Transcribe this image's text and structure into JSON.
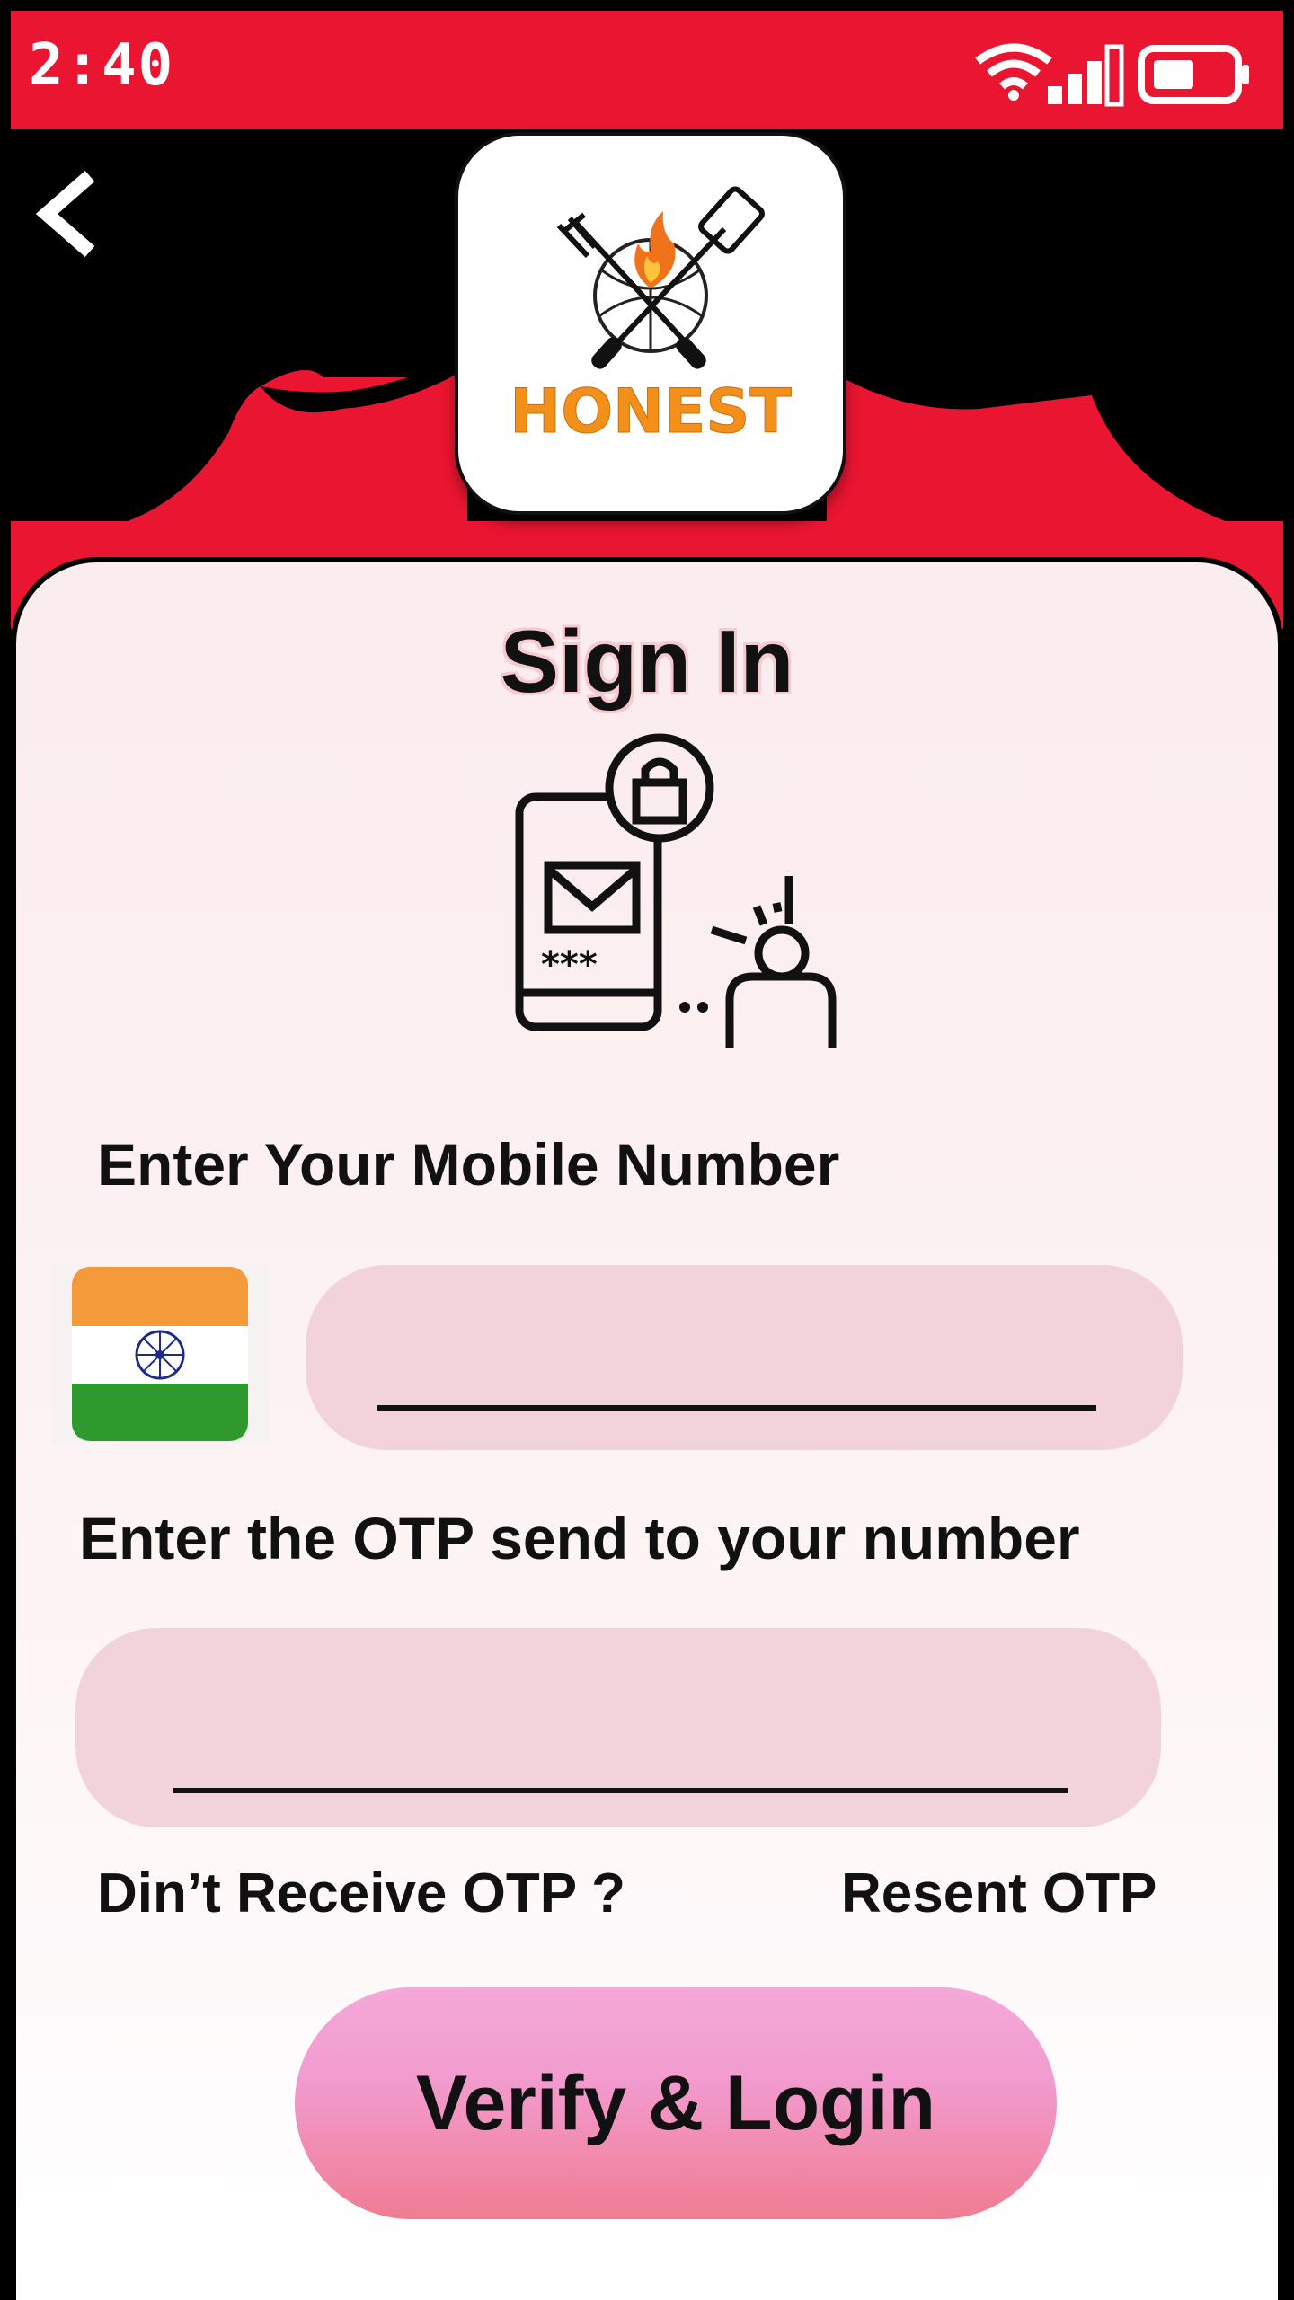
{
  "status_bar": {
    "time": "2:40",
    "battery_icon": "battery-half-icon",
    "signal_icon": "cell-signal-icon",
    "wifi_icon": "wifi-icon"
  },
  "header": {
    "back_icon": "chevron-left-icon",
    "logo_text": "HONEST"
  },
  "main": {
    "title": "Sign In",
    "mobile_label": "Enter Your Mobile Number",
    "mobile_value": "",
    "country_flag": "india-flag",
    "otp_label": "Enter the OTP send to your number",
    "otp_value": "",
    "didnt_receive": "Din’t Receive OTP ?",
    "resend": "Resent OTP",
    "verify_button": "Verify & Login"
  },
  "colors": {
    "brand_red": "#ea1530",
    "logo_orange": "#f2901a",
    "input_fill": "#f2d3dc",
    "button_pink": "#f4a8d8"
  }
}
